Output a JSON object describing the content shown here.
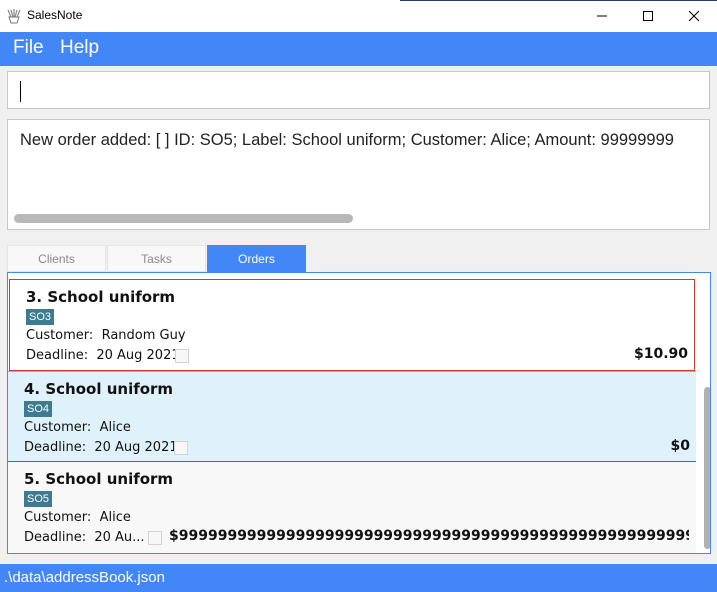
{
  "window": {
    "title": "SalesNote",
    "icon": "app-logo-icon",
    "controls": [
      "minimize-icon",
      "maximize-icon",
      "close-icon"
    ]
  },
  "menu": {
    "items": [
      "File",
      "Help"
    ]
  },
  "command_box": {
    "value": ""
  },
  "result_display": {
    "message": "New order added: [ ] ID: SO5; Label: School uniform; Customer: Alice; Amount: 99999999"
  },
  "tabs": {
    "items": [
      "Clients",
      "Tasks",
      "Orders"
    ],
    "active": "Orders"
  },
  "orders": {
    "customer_label": "Customer:",
    "deadline_label": "Deadline:",
    "items": [
      {
        "title": "3. School uniform",
        "id": "SO3",
        "customer": "Random Guy",
        "deadline": "20 Aug 2021",
        "amount": "$10.90",
        "done": false,
        "selected": true
      },
      {
        "title": "4. School uniform",
        "id": "SO4",
        "customer": "Alice",
        "deadline": "20 Aug 2021",
        "amount": "$0",
        "done": false,
        "selected": false
      },
      {
        "title": "5. School uniform",
        "id": "SO5",
        "customer": "Alice",
        "deadline": "20 Au...",
        "amount": "$9999999999999999999999999999999999999999999999999999999...",
        "done": false,
        "selected": false
      }
    ]
  },
  "status_bar": {
    "path": ".\\data\\addressBook.json"
  },
  "colors": {
    "accent": "#4287f5",
    "badge": "#3e7b91",
    "selected_border": "#d13a3a",
    "hover_row": "#dff2fb"
  }
}
